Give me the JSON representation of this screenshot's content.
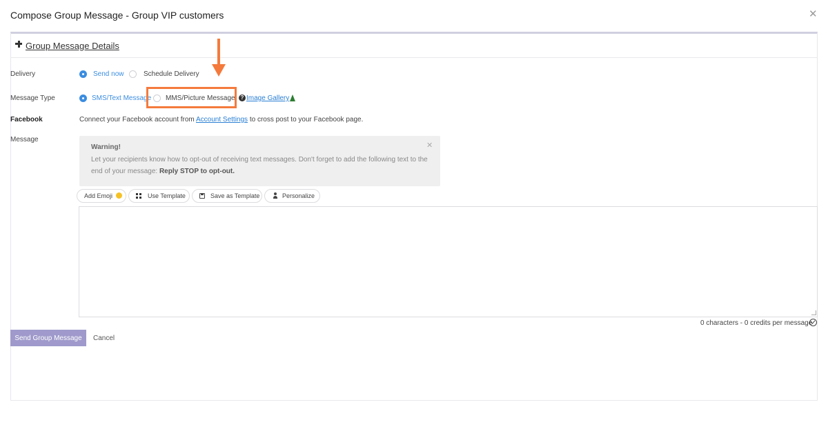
{
  "modal": {
    "title": "Compose Group Message - Group VIP customers"
  },
  "details": {
    "link_label": "Group Message Details"
  },
  "delivery": {
    "label": "Delivery",
    "options": [
      {
        "label": "Send now",
        "selected": true
      },
      {
        "label": "Schedule Delivery",
        "selected": false
      }
    ]
  },
  "message_type": {
    "label": "Message Type",
    "options": [
      {
        "label": "SMS/Text Message",
        "selected": true
      },
      {
        "label": "MMS/Picture Message",
        "selected": false
      }
    ],
    "gallery_link": "Image Gallery"
  },
  "facebook": {
    "label": "Facebook",
    "text_before": "Connect your Facebook account from",
    "link": "Account Settings",
    "text_after": "to cross post to your Facebook page."
  },
  "message": {
    "label": "Message",
    "value": "",
    "warning": {
      "title": "Warning!",
      "body": "Let your recipients know how to opt-out of receiving text messages. Don't forget to add the following text to the end of your message:",
      "emphasis": "Reply STOP to opt-out."
    },
    "toolbar": {
      "add_emoji": "Add Emoji",
      "use_template": "Use Template",
      "save_template": "Save as Template",
      "personalize": "Personalize"
    },
    "counter": "0 characters - 0 credits per message"
  },
  "actions": {
    "send": "Send Group Message",
    "cancel": "Cancel"
  },
  "colors": {
    "accent": "#3b8de0",
    "highlight": "#f47a3c",
    "send_button": "#9f9acb"
  }
}
